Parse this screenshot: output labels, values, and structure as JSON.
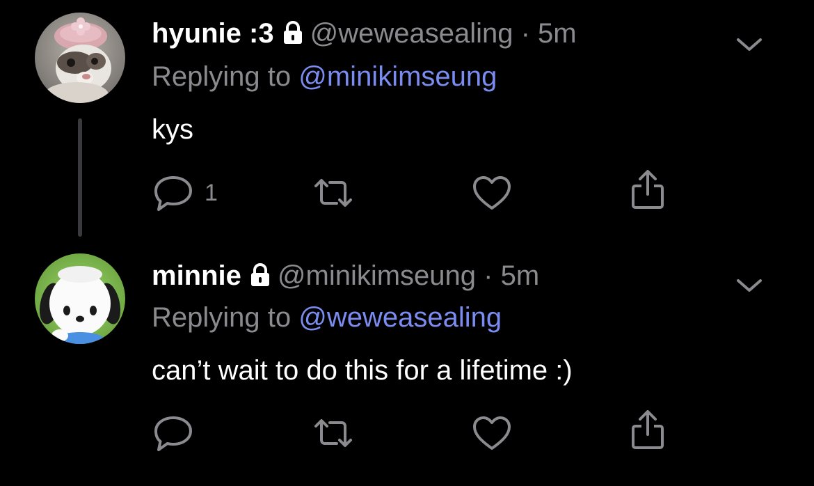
{
  "tweets": [
    {
      "display_name": "hyunie :3",
      "handle": "@weweasealing",
      "separator": "·",
      "time": "5m",
      "replying_prefix": "Replying to",
      "replying_to": "@minikimseung",
      "text": "kys",
      "reply_count": "1",
      "avatar": "ferret-with-pink-flower-hat",
      "protected": true
    },
    {
      "display_name": "minnie",
      "handle": "@minikimseung",
      "separator": "·",
      "time": "5m",
      "replying_prefix": "Replying to",
      "replying_to": "@weweasealing",
      "text": "can’t wait to do this for a lifetime :)",
      "reply_count": "",
      "avatar": "pochacco-character",
      "protected": true
    }
  ],
  "icons": {
    "reply": "reply-icon",
    "retweet": "retweet-icon",
    "like": "heart-icon",
    "share": "share-icon",
    "menu": "chevron-down-icon",
    "protected": "lock-icon"
  },
  "colors": {
    "background": "#000000",
    "text": "#ffffff",
    "secondary": "#8b8b8f",
    "link": "#7b8cf0",
    "thread_line": "#3a3a3c"
  }
}
